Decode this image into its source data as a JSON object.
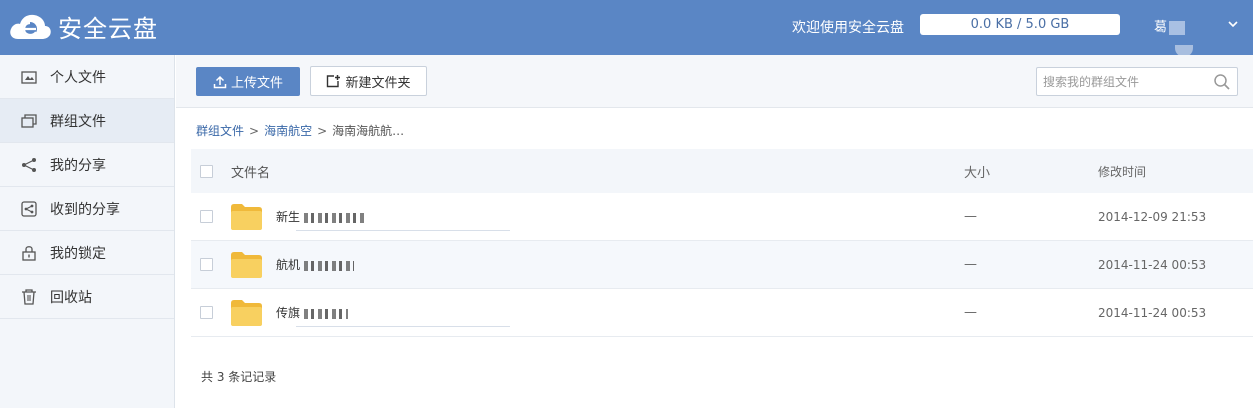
{
  "header": {
    "logo_text": "安全云盘",
    "welcome": "欢迎使用安全云盘",
    "quota": "0.0 KB / 5.0 GB",
    "user_name": "葛"
  },
  "sidebar": {
    "items": [
      {
        "label": "个人文件",
        "icon": "personal-files-icon"
      },
      {
        "label": "群组文件",
        "icon": "group-files-icon",
        "active": true
      },
      {
        "label": "我的分享",
        "icon": "share-icon"
      },
      {
        "label": "收到的分享",
        "icon": "received-share-icon"
      },
      {
        "label": "我的锁定",
        "icon": "lock-icon"
      },
      {
        "label": "回收站",
        "icon": "trash-icon"
      }
    ]
  },
  "toolbar": {
    "upload_label": "上传文件",
    "new_folder_label": "新建文件夹",
    "search_placeholder": "搜索我的群组文件"
  },
  "breadcrumb": {
    "items": [
      "群组文件",
      "海南航空"
    ],
    "current": "海南海航航…",
    "separator": ">"
  },
  "table": {
    "headers": {
      "name": "文件名",
      "size": "大小",
      "time": "修改时间"
    },
    "rows": [
      {
        "name": "新生",
        "size": "—",
        "time": "2014-12-09 21:53"
      },
      {
        "name": "航机",
        "size": "—",
        "time": "2014-11-24 00:53"
      },
      {
        "name": "传旗",
        "size": "—",
        "time": "2014-11-24 00:53"
      }
    ]
  },
  "footer": {
    "record_count": "共 3 条记记录"
  },
  "colors": {
    "header_bg": "#5a86c5",
    "accent": "#5a86c5",
    "folder": "#f6c342"
  }
}
